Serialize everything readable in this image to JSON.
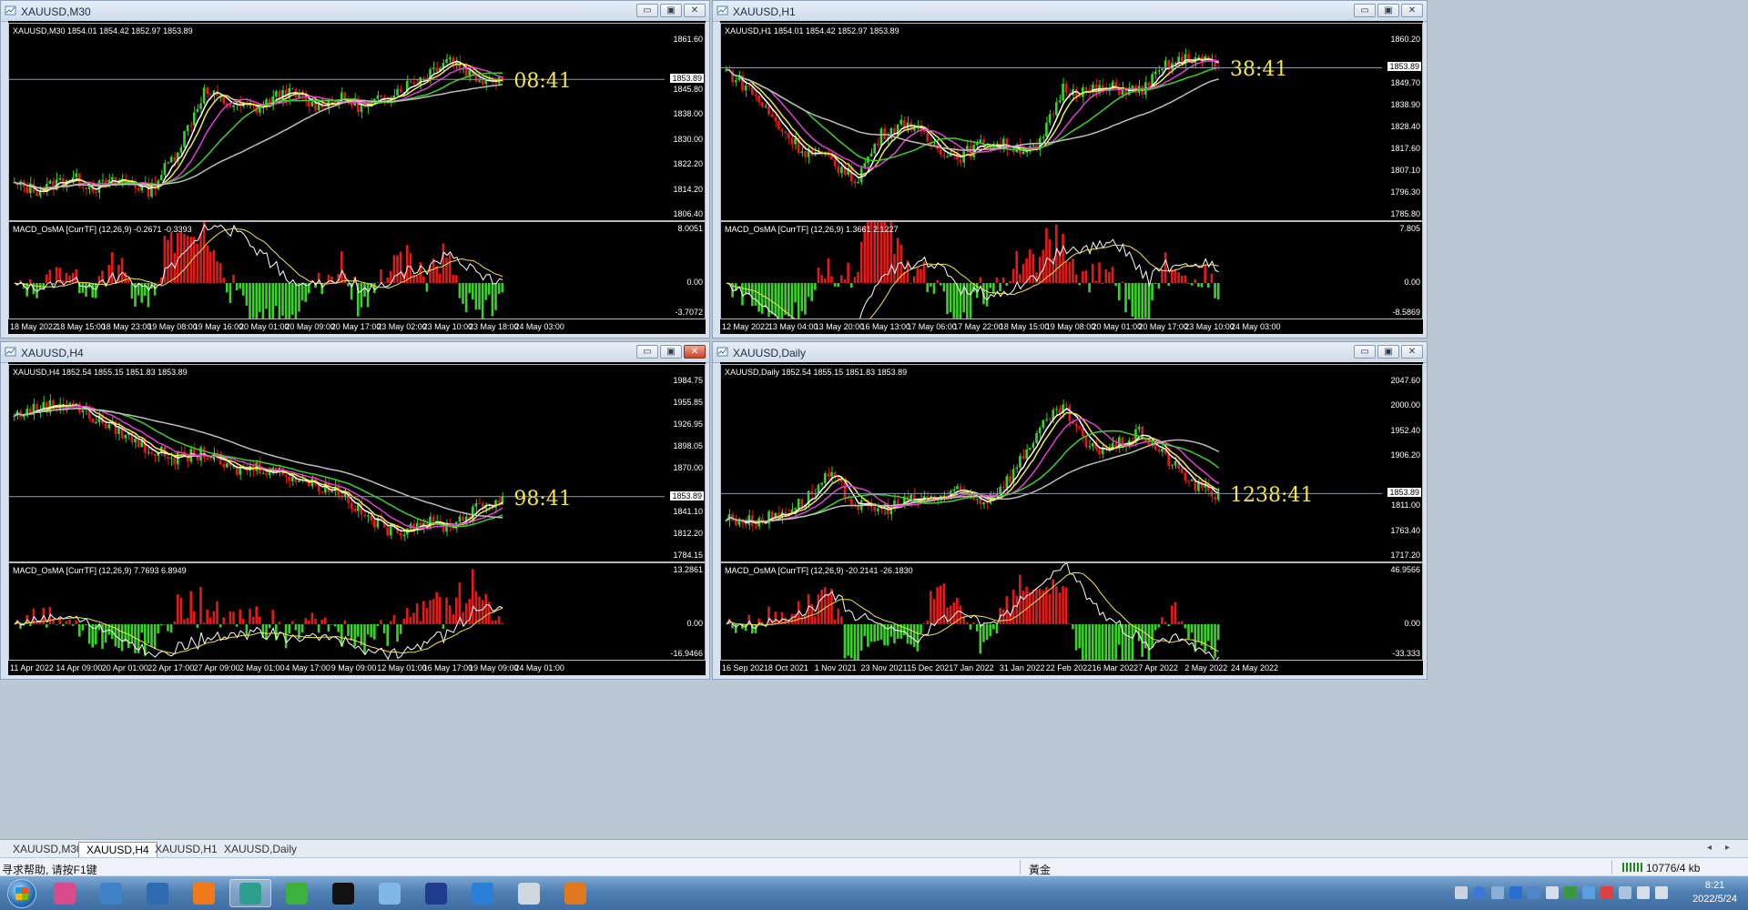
{
  "windows": [
    {
      "id": "m30",
      "title": "XAUUSD,M30",
      "main_label": "XAUUSD,M30  1854.01 1854.42 1852.97 1853.89",
      "macd_label": "MACD_OsMA [CurrTF] (12,26,9) -0.2671 -0.3393",
      "price_ticks": [
        "1861.60",
        "1853.89",
        "1845.80",
        "1838.00",
        "1830.00",
        "1822.20",
        "1814.20",
        "1806.40"
      ],
      "current_price": "1853.89",
      "macd_ticks": [
        "8.0051",
        "0.00",
        "-3.7072"
      ],
      "time_labels": [
        "18 May 2022",
        "18 May 15:00",
        "18 May 23:00",
        "19 May 08:00",
        "19 May 16:00",
        "20 May 01:00",
        "20 May 09:00",
        "20 May 17:00",
        "23 May 02:00",
        "23 May 10:00",
        "23 May 18:00",
        "24 May 03:00"
      ],
      "timer": "08:41",
      "close_hot": false,
      "trend": [
        0.15,
        0.12,
        0.2,
        0.14,
        0.18,
        0.12,
        0.35,
        0.7,
        0.62,
        0.6,
        0.7,
        0.62,
        0.66,
        0.6,
        0.7,
        0.78,
        0.9,
        0.78,
        0.78
      ]
    },
    {
      "id": "h1",
      "title": "XAUUSD,H1",
      "main_label": "XAUUSD,H1  1854.01 1854.42 1852.97 1853.89",
      "macd_label": "MACD_OsMA [CurrTF] (12,26,9) 1.3661 2.1227",
      "price_ticks": [
        "1860.20",
        "1853.89",
        "1849.70",
        "1838.90",
        "1828.40",
        "1817.60",
        "1807.10",
        "1796.30",
        "1785.80"
      ],
      "current_price": "1853.89",
      "macd_ticks": [
        "7.805",
        "0.00",
        "-8.5869"
      ],
      "time_labels": [
        "12 May 2022",
        "13 May 04:00",
        "13 May 20:00",
        "16 May 13:00",
        "17 May 06:00",
        "17 May 22:00",
        "18 May 15:00",
        "19 May 08:00",
        "20 May 01:00",
        "20 May 17:00",
        "23 May 10:00",
        "24 May 03:00"
      ],
      "timer": "38:41",
      "close_hot": false,
      "trend": [
        0.82,
        0.7,
        0.5,
        0.35,
        0.3,
        0.18,
        0.45,
        0.52,
        0.38,
        0.32,
        0.4,
        0.38,
        0.35,
        0.72,
        0.7,
        0.72,
        0.7,
        0.85,
        0.9,
        0.84
      ]
    },
    {
      "id": "h4",
      "title": "XAUUSD,H4",
      "main_label": "XAUUSD,H4  1852.54 1855.15 1851.83 1853.89",
      "macd_label": "MACD_OsMA [CurrTF] (12,26,9) 7.7693 6.8949",
      "price_ticks": [
        "1984.75",
        "1955.85",
        "1926.95",
        "1898.05",
        "1870.00",
        "1853.89",
        "1841.10",
        "1812.20",
        "1784.15"
      ],
      "current_price": "1853.89",
      "macd_ticks": [
        "13.2861",
        "0.00",
        "-16.9466"
      ],
      "time_labels": [
        "11 Apr 2022",
        "14 Apr 09:00",
        "20 Apr 01:00",
        "22 Apr 17:00",
        "27 Apr 09:00",
        "2 May 01:00",
        "4 May 17:00",
        "9 May 09:00",
        "12 May 01:00",
        "16 May 17:00",
        "19 May 09:00",
        "24 May 01:00"
      ],
      "timer": "98:41",
      "close_hot": true,
      "trend": [
        0.8,
        0.85,
        0.88,
        0.78,
        0.7,
        0.6,
        0.55,
        0.58,
        0.48,
        0.5,
        0.46,
        0.4,
        0.36,
        0.2,
        0.12,
        0.18,
        0.15,
        0.25,
        0.32
      ]
    },
    {
      "id": "daily",
      "title": "XAUUSD,Daily",
      "main_label": "XAUUSD,Daily  1852.54 1855.15 1851.83 1853.89",
      "macd_label": "MACD_OsMA [CurrTF] (12,26,9) -20.2141 -26.1830",
      "price_ticks": [
        "2047.60",
        "2000.00",
        "1952.40",
        "1906.20",
        "1853.89",
        "1811.00",
        "1763.40",
        "1717.20"
      ],
      "current_price": "1853.89",
      "macd_ticks": [
        "46.9566",
        "0.00",
        "-33.333"
      ],
      "time_labels": [
        "16 Sep 2021",
        "8 Oct 2021",
        "1 Nov 2021",
        "23 Nov 2021",
        "15 Dec 2021",
        "7 Jan 2022",
        "31 Jan 2022",
        "22 Feb 2022",
        "16 Mar 2022",
        "7 Apr 2022",
        "2 May 2022",
        "24 May 2022"
      ],
      "timer": "1238:41",
      "close_hot": false,
      "trend": [
        0.2,
        0.18,
        0.22,
        0.3,
        0.45,
        0.28,
        0.25,
        0.3,
        0.32,
        0.35,
        0.3,
        0.45,
        0.7,
        0.85,
        0.6,
        0.62,
        0.7,
        0.55,
        0.4,
        0.33
      ]
    }
  ],
  "tabs": [
    "XAUUSD,M30",
    "XAUUSD,H4",
    "XAUUSD,H1",
    "XAUUSD,Daily"
  ],
  "active_tab": "XAUUSD,H4",
  "status": {
    "help": "寻求帮助, 请按F1键",
    "profile": "黃金",
    "traffic": "10776/4 kb"
  },
  "clock": {
    "time": "8:21",
    "date": "2022/5/24"
  },
  "taskbar_icons": [
    "paint-icon",
    "people-icon",
    "monitor-icon",
    "refresh-icon",
    "app-icon",
    "wechat-icon",
    "capcut-icon",
    "notes-icon",
    "photoshop-icon",
    "feedback-icon",
    "calculator-icon",
    "media-player-icon"
  ],
  "colors": {
    "bull": "#3cd02a",
    "bear": "#e11a1a",
    "timer": "#f2e64a"
  }
}
